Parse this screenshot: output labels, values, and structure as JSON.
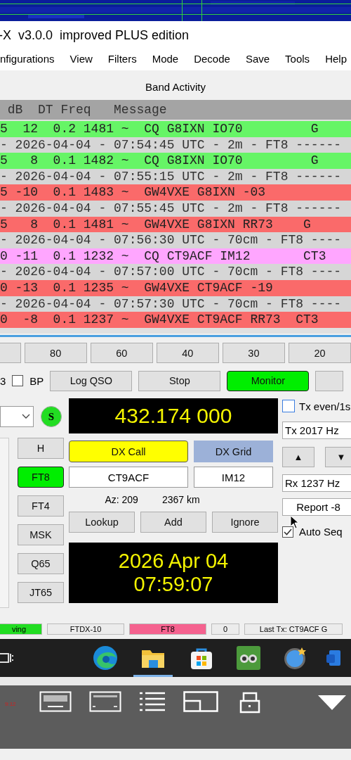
{
  "window": {
    "title": "-X  v3.0.0  improved PLUS edition"
  },
  "menu": [
    "nfigurations",
    "View",
    "Filters",
    "Mode",
    "Decode",
    "Save",
    "Tools",
    "Help"
  ],
  "band_activity": {
    "title": "Band Activity",
    "header": " dB  DT Freq   Message",
    "rows": [
      {
        "kind": "decode",
        "color": "#66f566",
        "text": "5  12  0.2 1481 ~  CQ G8IXN IO70         G"
      },
      {
        "kind": "separator",
        "text": "- 2026-04-04 - 07:54:45 UTC - 2m - FT8 ------"
      },
      {
        "kind": "decode",
        "color": "#66f566",
        "text": "5   8  0.1 1482 ~  CQ G8IXN IO70         G"
      },
      {
        "kind": "separator",
        "text": "- 2026-04-04 - 07:55:15 UTC - 2m - FT8 ------"
      },
      {
        "kind": "decode",
        "color": "#fa6a6a",
        "text": "5 -10  0.1 1483 ~  GW4VXE G8IXN -03"
      },
      {
        "kind": "separator",
        "text": "- 2026-04-04 - 07:55:45 UTC - 2m - FT8 ------"
      },
      {
        "kind": "decode",
        "color": "#fa6a6a",
        "text": "5   8  0.1 1481 ~  GW4VXE G8IXN RR73    G"
      },
      {
        "kind": "separator",
        "text": "- 2026-04-04 - 07:56:30 UTC - 70cm - FT8 ----"
      },
      {
        "kind": "decode",
        "color": "#ffa6ff",
        "text": "0 -11  0.1 1232 ~  CQ CT9ACF IM12       CT3"
      },
      {
        "kind": "separator",
        "text": "- 2026-04-04 - 07:57:00 UTC - 70cm - FT8 ----"
      },
      {
        "kind": "decode",
        "color": "#fa6a6a",
        "text": "0 -13  0.1 1235 ~  GW4VXE CT9ACF -19"
      },
      {
        "kind": "separator",
        "text": "- 2026-04-04 - 07:57:30 UTC - 70cm - FT8 ----"
      },
      {
        "kind": "decode",
        "color": "#fa6a6a",
        "text": "0  -8  0.1 1237 ~  GW4VXE CT9ACF RR73  CT3"
      }
    ]
  },
  "bands": [
    "80",
    "60",
    "40",
    "30",
    "20"
  ],
  "controls": {
    "left_text": "3",
    "bp": {
      "label": "BP",
      "checked": false
    },
    "buttons": [
      {
        "label": "Log QSO",
        "selected": false
      },
      {
        "label": "Stop",
        "selected": false
      },
      {
        "label": "Monitor",
        "selected": true
      }
    ]
  },
  "s_badge": "S",
  "frequency": "432.174 000",
  "modes": [
    {
      "label": "H",
      "selected": false
    },
    {
      "label": "FT8",
      "selected": true
    },
    {
      "label": "FT4",
      "selected": false
    },
    {
      "label": "MSK",
      "selected": false
    },
    {
      "label": "Q65",
      "selected": false
    },
    {
      "label": "JT65",
      "selected": false
    }
  ],
  "dx_call": {
    "label": "DX Call",
    "value": "CT9ACF"
  },
  "dx_grid": {
    "label": "DX Grid",
    "value": "IM12"
  },
  "azimuth": "Az: 209",
  "distance": "2367 km",
  "actions": [
    "Lookup",
    "Add",
    "Ignore"
  ],
  "clock": {
    "date": "2026 Apr 04",
    "time": "07:59:07"
  },
  "tx_even": {
    "label": "Tx even/1s",
    "checked": false
  },
  "tx_freq": "Tx  2017 Hz",
  "rx_freq": "Rx  1237 Hz",
  "report": "Report -8",
  "arrows": [
    "▲",
    "▼"
  ],
  "auto_seq": {
    "label": "Auto Seq",
    "checked": true
  },
  "status_bar": [
    {
      "text": "ving",
      "color": "#22dd22"
    },
    {
      "text": "FTDX-10",
      "color": "#ececec"
    },
    {
      "text": "FT8",
      "color": "#f5628f"
    },
    {
      "text": "0",
      "color": "#ececec"
    },
    {
      "text": "Last Tx: CT9ACF G",
      "color": "#ececec"
    }
  ],
  "remote_bar": {
    "time": "9:12"
  }
}
